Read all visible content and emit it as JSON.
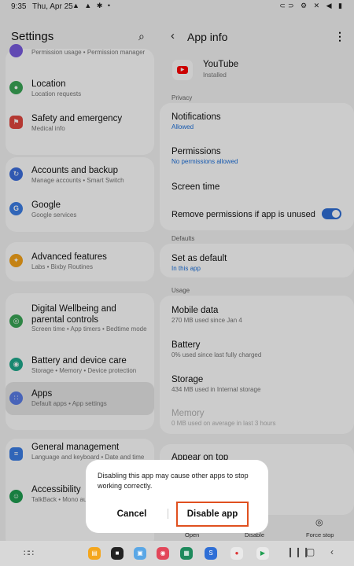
{
  "status_bar": {
    "time": "9:35",
    "date": "Thu, Apr 25",
    "left_icons": "▲ ▲ ✱ •",
    "right_icons": "⊂⊃ ⚙ ✕ ◀ ▮"
  },
  "settings_pane": {
    "title": "Settings",
    "partial_item_subtitle": "Permission usage  •  Permission manager",
    "items": [
      {
        "label": "Location",
        "subtitle": "Location requests",
        "icon": "location-icon",
        "color": "#3aa757"
      },
      {
        "label": "Safety and emergency",
        "subtitle": "Medical info",
        "icon": "safety-icon",
        "color": "#e2473f"
      },
      {
        "label": "Accounts and backup",
        "subtitle": "Manage accounts  •  Smart Switch",
        "icon": "accounts-icon",
        "color": "#3d6fde"
      },
      {
        "label": "Google",
        "subtitle": "Google services",
        "icon": "google-icon",
        "color": "#3d7fe6"
      },
      {
        "label": "Advanced features",
        "subtitle": "Labs  •  Bixby Routines",
        "icon": "advanced-features-icon",
        "color": "#f5a31a"
      },
      {
        "label": "Digital Wellbeing and parental controls",
        "subtitle": "Screen time  •  App timers  •  Bedtime mode",
        "icon": "wellbeing-icon",
        "color": "#3aa757"
      },
      {
        "label": "Battery and device care",
        "subtitle": "Storage  •  Memory  •  Device protection",
        "icon": "device-care-icon",
        "color": "#1ea98c"
      },
      {
        "label": "Apps",
        "subtitle": "Default apps  •  App settings",
        "icon": "apps-icon",
        "color": "#5a7de8"
      },
      {
        "label": "General management",
        "subtitle": "Language and keyboard  •  Date and time",
        "icon": "general-management-icon",
        "color": "#3d7fe6"
      },
      {
        "label": "Accessibility",
        "subtitle": "TalkBack  •  Mono audio  •  Assistant menu",
        "icon": "accessibility-icon",
        "color": "#1e9e50"
      }
    ]
  },
  "app_info": {
    "title": "App info",
    "app_name": "YouTube",
    "app_status": "Installed",
    "sections": {
      "privacy": "Privacy",
      "defaults": "Defaults",
      "usage": "Usage"
    },
    "privacy_items": [
      {
        "label": "Notifications",
        "subtitle": "Allowed"
      },
      {
        "label": "Permissions",
        "subtitle": "No permissions allowed"
      },
      {
        "label": "Screen time",
        "subtitle": ""
      },
      {
        "label": "Remove permissions if app is unused",
        "subtitle": ""
      }
    ],
    "remove_permissions_toggle": true,
    "defaults_items": [
      {
        "label": "Set as default",
        "subtitle": "In this app"
      }
    ],
    "usage_items": [
      {
        "label": "Mobile data",
        "subtitle": "270 MB used since Jan 4"
      },
      {
        "label": "Battery",
        "subtitle": "0% used since last fully charged"
      },
      {
        "label": "Storage",
        "subtitle": "434 MB used in Internal storage"
      },
      {
        "label": "Memory",
        "subtitle": "0 MB used on average in last 3 hours"
      }
    ],
    "appear_on_top": "Appear on top",
    "bottom_actions": {
      "open": "Open",
      "disable": "Disable",
      "force_stop": "Force stop"
    }
  },
  "dialog": {
    "message": "Disabling this app may cause other apps to stop working correctly.",
    "cancel": "Cancel",
    "confirm": "Disable app",
    "highlight_color": "#e0501f"
  },
  "dock_apps": [
    {
      "icon": "my-files-icon",
      "color": "#f4a61d"
    },
    {
      "icon": "camera-app-icon",
      "color": "#222222"
    },
    {
      "icon": "gallery-icon",
      "color": "#5aa7e6"
    },
    {
      "icon": "camera-icon",
      "color": "#e2475a"
    },
    {
      "icon": "office-icon",
      "color": "#1e8a5c"
    },
    {
      "icon": "s-app-icon",
      "color": "#2f6fd6"
    },
    {
      "icon": "chrome-icon",
      "color": "#eaeaea"
    },
    {
      "icon": "play-store-icon",
      "color": "#eaeaea"
    }
  ]
}
